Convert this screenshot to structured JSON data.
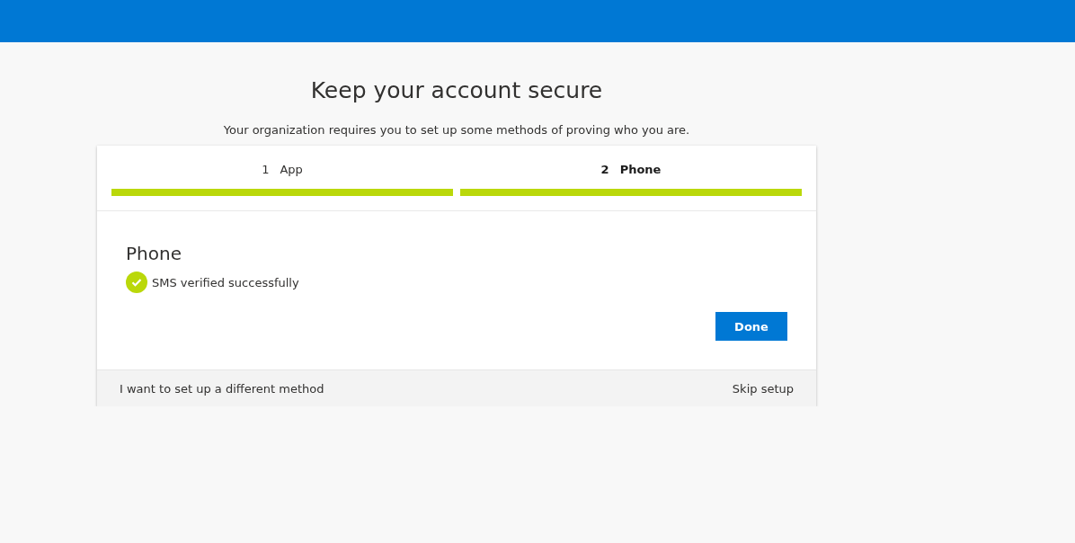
{
  "title": "Keep your account secure",
  "subtitle": "Your organization requires you to set up some methods of proving who you are.",
  "steps": [
    {
      "number": "1",
      "label": "App",
      "selected": false,
      "completed": true
    },
    {
      "number": "2",
      "label": "Phone",
      "selected": true,
      "completed": true
    }
  ],
  "section_title": "Phone",
  "status": {
    "text": "SMS verified successfully",
    "verified": true
  },
  "primary_button": "Done",
  "footer": {
    "alternate_link": "I want to set up a different method",
    "skip_link": "Skip setup"
  }
}
